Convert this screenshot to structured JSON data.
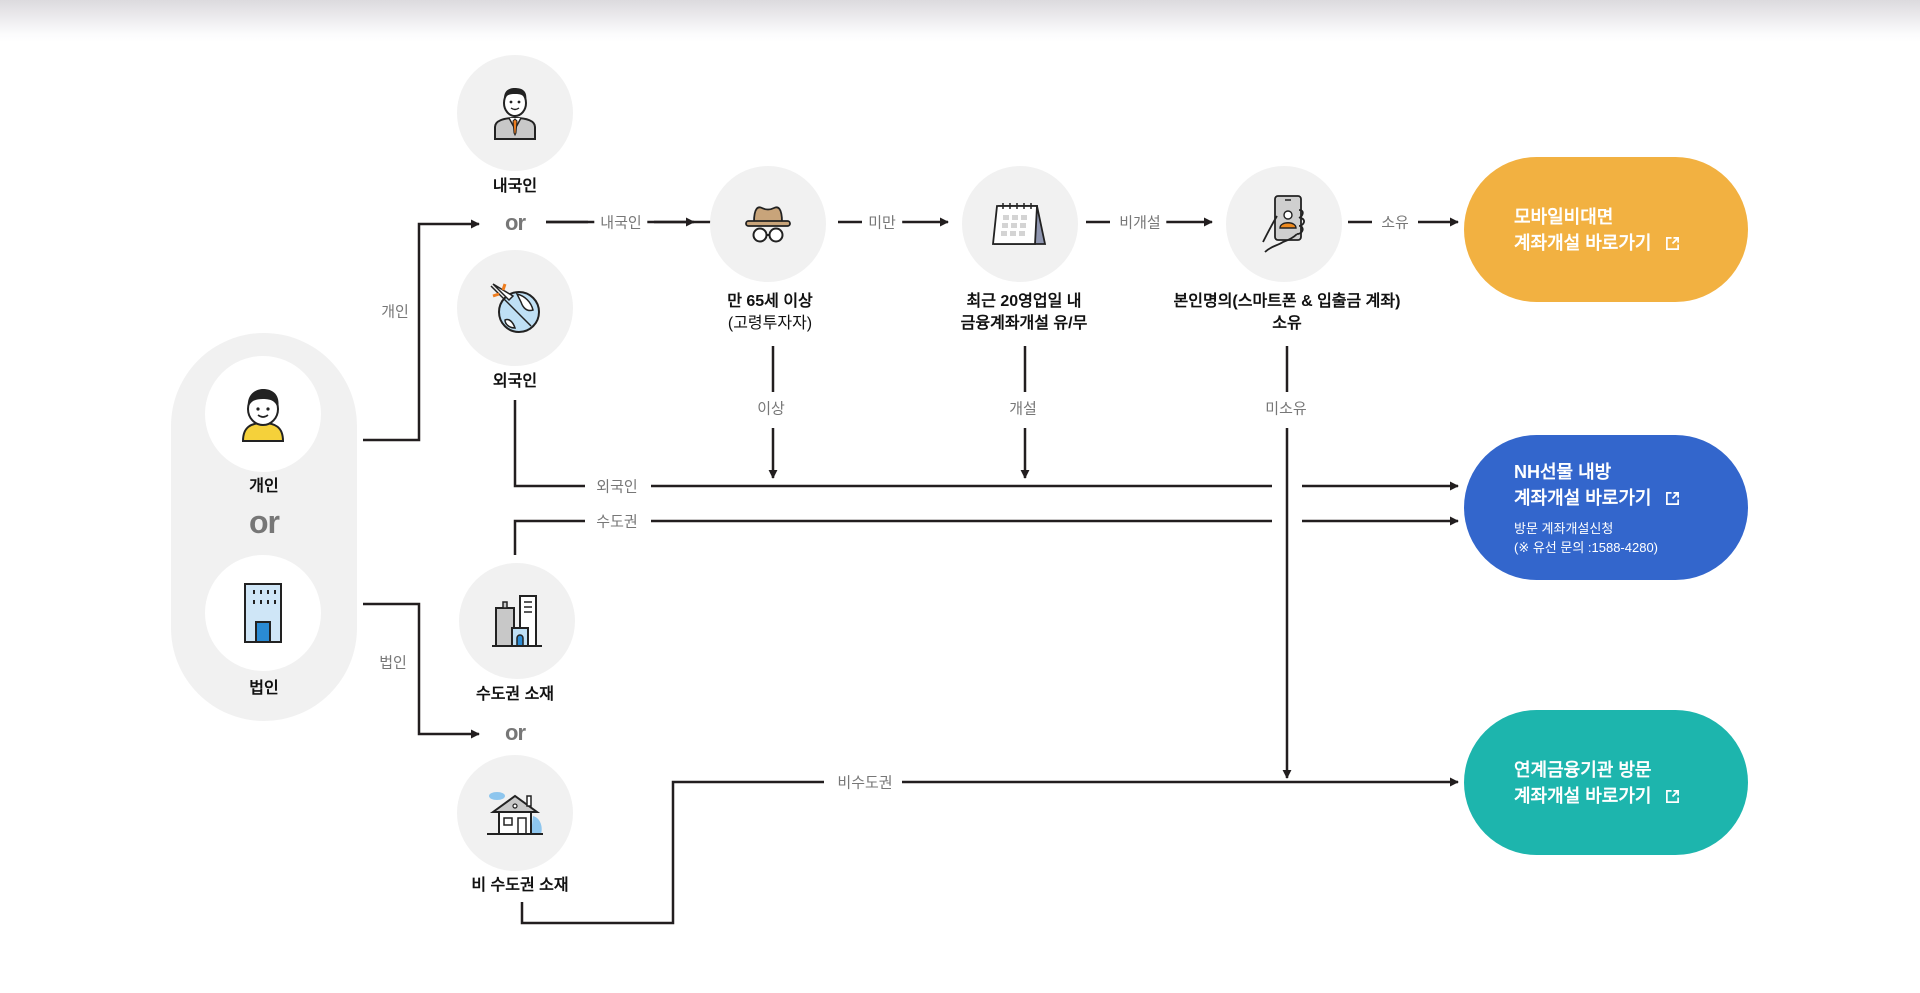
{
  "colors": {
    "orange": "#f2b141",
    "blue": "#3366cc",
    "teal": "#1db5ad",
    "line": "#221e1f",
    "edge_label": "#777777"
  },
  "start": {
    "individual_label": "개인",
    "or_label": "or",
    "corporate_label": "법인"
  },
  "individual_branch": {
    "edge_label": "개인",
    "domestic_label": "내국인",
    "or_label": "or",
    "foreign_label": "외국인"
  },
  "corporate_branch": {
    "edge_label": "법인",
    "capital_label": "수도권 소재",
    "or_label": "or",
    "noncapital_label": "비 수도권 소재"
  },
  "steps": [
    {
      "icon": "elderly-icon",
      "title": "만 65세 이상",
      "sub": "(고령투자자)"
    },
    {
      "icon": "calendar-icon",
      "title": "최근 20영업일 내",
      "sub": "금융계좌개설 유/무"
    },
    {
      "icon": "smartphone-icon",
      "title": "본인명의(스마트폰 & 입출금 계좌)",
      "sub": "소유"
    }
  ],
  "edges": {
    "domestic": "내국인",
    "under": "미만",
    "not_opened": "비개설",
    "owned": "소유",
    "over": "이상",
    "opened": "개설",
    "not_owned": "미소유",
    "foreigner": "외국인",
    "capital": "수도권",
    "non_capital": "비수도권"
  },
  "results": [
    {
      "line1": "모바일비대면",
      "line2": "계좌개설 바로가기",
      "sub1": "",
      "sub2": ""
    },
    {
      "line1": "NH선물 내방",
      "line2": "계좌개설 바로가기",
      "sub1": "방문 계좌개설신청",
      "sub2": "(※ 유선 문의 :1588-4280)"
    },
    {
      "line1": "연계금융기관 방문",
      "line2": "계좌개설 바로가기",
      "sub1": "",
      "sub2": ""
    }
  ]
}
